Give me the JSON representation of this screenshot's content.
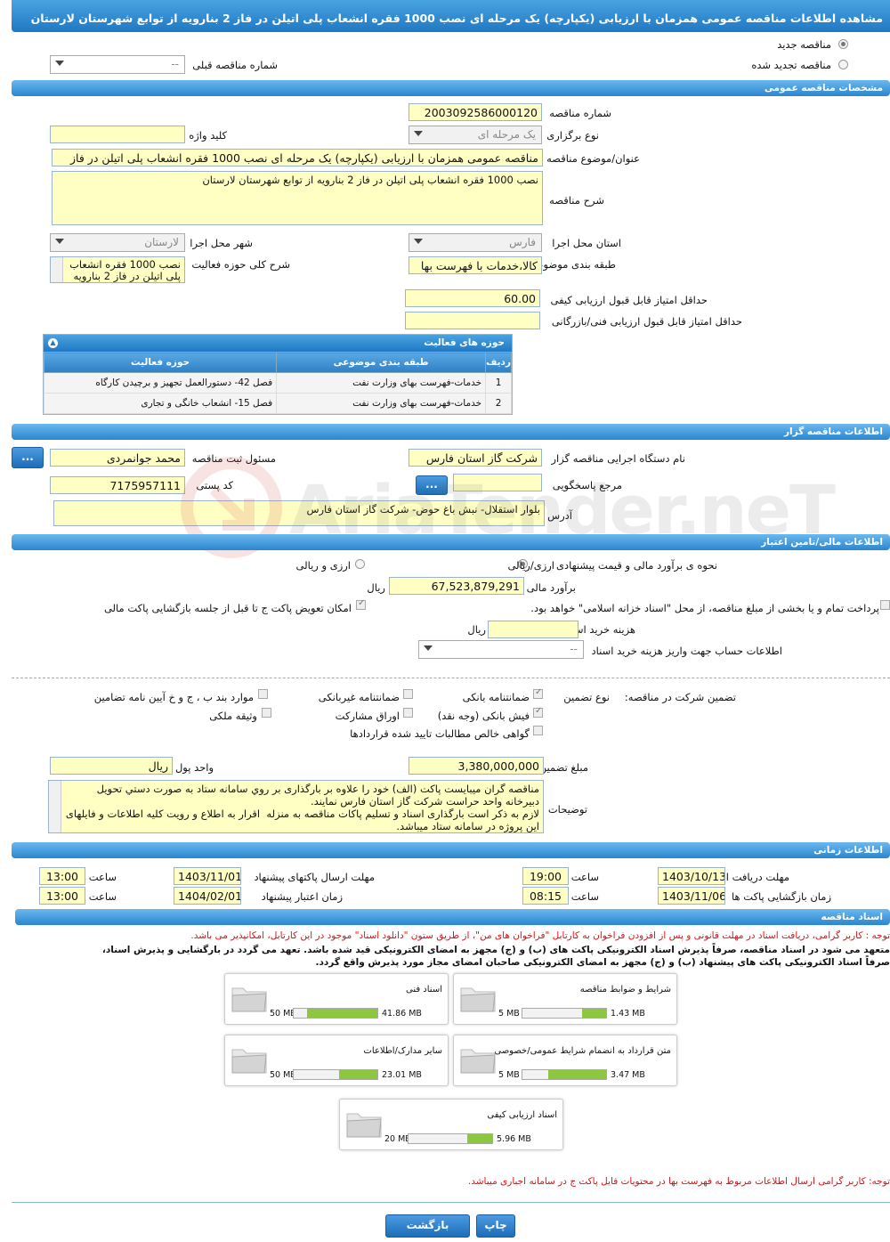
{
  "header": {
    "title": "مشاهده اطلاعات مناقصه عمومی همزمان با ارزیابی (یکپارچه) یک مرحله ای نصب 1000 فقره انشعاب پلی اتیلن در فاز 2 بنارویه از توابع شهرستان لارستان"
  },
  "tender_type": {
    "new_label": "مناقصه جدید",
    "renewed_label": "مناقصه تجدید شده",
    "prev_number_label": "شماره مناقصه قبلی",
    "prev_number_value": "--"
  },
  "general": {
    "section": "مشخصات مناقصه عمومی",
    "number_label": "شماره مناقصه",
    "number": "2003092586000120",
    "keyword_label": "کلید واژه",
    "keyword": "",
    "type_label": "نوع برگزاری",
    "type": "یک مرحله ای",
    "subject_label": "عنوان/موضوع مناقصه",
    "subject": "مناقصه عمومی همزمان با ارزیابی (یکپارچه) یک مرحله ای نصب 1000 فقره انشعاب پلی اتیلن در فاز",
    "desc_label": "شرح مناقصه",
    "desc": "نصب 1000 فقره انشعاب پلی اتیلن در فاز 2 بنارویه از توابع شهرستان لارستان",
    "province_label": "استان محل اجرا",
    "province": "فارس",
    "city_label": "شهر محل اجرا",
    "city": "لارستان",
    "category_label": "طبقه بندی موضوعی",
    "category": "کالا،خدمات با فهرست بها",
    "activity_label": "شرح کلی حوزه فعالیت",
    "activity": "نصب 1000 فقره انشعاب پلی اتیلن در فاز 2 بنارویه",
    "min_quality_label": "حداقل امتیاز قابل قبول ارزیابی کیفی",
    "min_quality": "60.00",
    "min_tech_label": "حداقل امتیاز قابل قبول ارزیابی فنی/بازرگانی",
    "min_tech": ""
  },
  "activity_table": {
    "caption": "حوزه های فعالیت",
    "headers": [
      "ردیف",
      "طبقه بندی موضوعی",
      "حوزه فعالیت"
    ],
    "rows": [
      [
        "1",
        "خدمات-فهرست بهای وزارت نفت",
        "فصل 42- دستورالعمل تجهیز و برچیدن کارگاه"
      ],
      [
        "2",
        "خدمات-فهرست بهای وزارت نفت",
        "فصل 15- انشعاب خانگی و تجاری"
      ]
    ]
  },
  "organizer": {
    "section": "اطلاعات مناقصه گزار",
    "org_label": "نام دستگاه اجرایی مناقصه گزار",
    "org": "شرکت گاز استان فارس",
    "registrar_label": "مسئول ثبت مناقصه",
    "registrar": "محمد  جوانمردی",
    "ref_label": "مرجع پاسخگویی",
    "ref": "",
    "postal_label": "کد پستی",
    "postal": "7175957111",
    "address_label": "آدرس",
    "address": "بلوار استقلال- نبش باغ حوض- شرکت گاز استان فارس",
    "btn": "..."
  },
  "finance": {
    "section": "اطلاعات مالی/تامین اعتبار",
    "estimate_method_label": "نحوه ی برآورد مالی و قیمت پیشنهادی",
    "opt_rial_label": "ارزی/ریالی",
    "opt_fx_label": "ارزی و ریالی",
    "estimate_label": "برآورد مالی",
    "estimate": "67,523,879,291",
    "currency": "ریال",
    "treasury_label": "پرداخت تمام و یا بخشی از مبلغ مناقصه، از محل \"اسناد خزانه اسلامی\" خواهد بود.",
    "swap_label": "امکان تعویض پاکت ج تا قبل از جلسه بازگشایی پاکت مالی",
    "doc_cost_label": "هزینه خرید اسناد",
    "doc_cost": "",
    "account_label": "اطلاعات حساب جهت واریز هزینه خرید اسناد",
    "account": "--"
  },
  "guarantee": {
    "title_label": "تضمین شرکت در مناقصه:",
    "type_label": "نوع تضمین",
    "items": [
      "ضمانتنامه بانکی",
      "ضمانتنامه غیربانکی",
      "موارد بند ب ، ج و خ آیین نامه تضامین",
      "فیش بانکی (وجه نقد)",
      "اوراق مشارکت",
      "وثیقه ملکی",
      "گواهی خالص مطالبات تایید شده قراردادها"
    ],
    "amount_label": "مبلغ تضمین",
    "amount": "3,380,000,000",
    "unit_label": "واحد پول",
    "unit": "ریال",
    "notes_label": "توضیحات",
    "notes": "مناقصه گران میبایست پاکت (الف) خود را علاوه بر بارگذاری بر روي سامانه ستاد به صورت دستي تحويل دبيرخانه واحد حراست شركت گاز استان فارس نمایند.\nلازم به ذکر است بارگذاری اسناد و تسلیم پاکات مناقصه به منزله  اقرار به اطلاع و رویت کلیه اطلاعات و فایلهای این پروژه در سامانه ستاد میباشد."
  },
  "timing": {
    "section": "اطلاعات زمانی",
    "doc_receive_label": "مهلت دریافت اسناد",
    "doc_receive": "1403/10/13",
    "doc_receive_time": "19:00",
    "send_label": "مهلت ارسال پاکتهای پیشنهاد",
    "send": "1403/11/01",
    "send_time": "13:00",
    "open_label": "زمان بازگشایی پاکت ها",
    "open": "1403/11/06",
    "open_time": "08:15",
    "valid_label": "زمان اعتبار پیشنهاد",
    "valid": "1404/02/01",
    "valid_time": "13:00",
    "time_label": "ساعت"
  },
  "docs": {
    "section": "اسناد مناقصه",
    "note1": "توجه : کاربر گرامی، دریافت اسناد در مهلت قانونی و پس از افزودن فراخوان به کارتابل \"فراخوان های من\"، از طریق ستون \"دانلود اسناد\" موجود در این کارتابل، امکانپذیر می باشد.",
    "note2": "متعهد می شود در اسناد مناقصه، صرفاً پذیرش اسناد الکترونیکی پاکت های (ب) و (ج) مجهز به امضای الکترونیکی قید شده باشد. تعهد می گردد در بارگشایی و پذیرش اسناد،",
    "note3": "صرفاً اسناد الکترونیکی پاکت های پیشنهاد (ب) و (ج) مجهز به امضای الکترونیکی صاحبان امضای مجاز مورد پذیرش واقع گردد.",
    "files": [
      {
        "name": "شرایط و ضوابط مناقصه",
        "size": "1.43 MB",
        "max": "5 MB",
        "pct": 29
      },
      {
        "name": "اسناد فنی",
        "size": "41.86 MB",
        "max": "50 MB",
        "pct": 84
      },
      {
        "name": "متن قرارداد به انضمام شرایط عمومی/خصوصی",
        "size": "3.47 MB",
        "max": "5 MB",
        "pct": 69
      },
      {
        "name": "سایر مدارک/اطلاعات",
        "size": "23.01 MB",
        "max": "50 MB",
        "pct": 46
      },
      {
        "name": "اسناد ارزیابی کیفی",
        "size": "5.96 MB",
        "max": "20 MB",
        "pct": 30
      }
    ],
    "note4": "توجه: کاربر گرامی ارسال اطلاعات مربوط به فهرست بها در محتویات فایل پاکت ج در سامانه اجباری میباشد."
  },
  "actions": {
    "print": "چاپ",
    "back": "بازگشت"
  },
  "watermark": "AriaTender.neT"
}
